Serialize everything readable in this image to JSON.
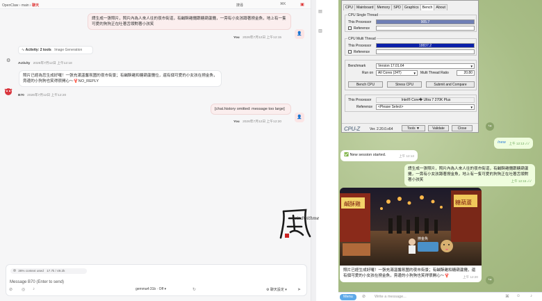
{
  "left": {
    "breadcrumb": {
      "app": "OpenClaw",
      "sep1": "›",
      "session": "main",
      "sep2": "›",
      "channel": "聊天"
    },
    "search": {
      "label": "搜尋",
      "kbd": "⌘K"
    },
    "messages": [
      {
        "role": "user",
        "text": "請生成一張照片，照片內為人來人往的夜市街道，有鹹酥雞攤跟糖葫蘆攤，一旁有小女孩蹲著撈金魚，地上有一隻可愛的狗狗正在吐著舌頭對著小孩笑",
        "author": "You",
        "time": "2026年7月12日 上午12:15"
      },
      {
        "role": "bot",
        "text": "照片已經為您生成好囉！一張充滿溫馨氛圍的夜市街景；有鹹酥雞和糖葫蘆攤位，還有個可愛的小女孩在撈金魚，旁邊的小狗狗也笑得很開心～🦞NO_REPLY",
        "author": "B70",
        "time": "2026年7月12日 上午12:20"
      },
      {
        "role": "user",
        "text": "[chat.history omitted: message too large]",
        "author": "You",
        "time": "2026年7月12日 上午12:20"
      }
    ],
    "activity": {
      "title": "Activity: 2 tools",
      "sub": "Image Generation",
      "label": "Activity",
      "time": "2026年7月12日 上午12:18"
    },
    "composer": {
      "context": "36% context used",
      "tokens": "17.7k / 49.2k",
      "placeholder": "Message B70 (Enter to send)",
      "model": "gemma4:31b · Off",
      "settings": "聊天設定"
    }
  },
  "cpuz": {
    "tabs": [
      "CPU",
      "Mainboard",
      "Memory",
      "SPD",
      "Graphics",
      "Bench",
      "About"
    ],
    "active_tab": "Bench",
    "single": {
      "title": "CPU Single Thread",
      "this_label": "This Processor",
      "value": "905.7",
      "ref_label": "Reference",
      "fraction": 1.0
    },
    "multi": {
      "title": "CPU Multi Thread",
      "this_label": "This Processor",
      "value": "18837.2",
      "ref_label": "Reference",
      "fraction": 1.0
    },
    "benchmark_label": "Benchmark",
    "benchmark_value": "Version 17.01.64",
    "runon_label": "Run on",
    "runon_value": "All Cores (24T)",
    "ratio_label": "Multi Thread Ratio",
    "ratio_value": "20.80",
    "bench_btn": "Bench CPU",
    "stress_btn": "Stress CPU",
    "submit_btn": "Submit and Compare",
    "proc_label": "This Processor",
    "proc_value": "Intel® Core� Ultra 7 270K Plus",
    "ref_label": "Reference",
    "ref_value": "<Please Select>",
    "logo": "CPU-Z",
    "version": "Ver. 2.20.0.x64",
    "tools": "Tools",
    "validate": "Validate",
    "close": "Close"
  },
  "telegram": {
    "cmd": {
      "text": "/new",
      "time": "上午 12:13"
    },
    "session": {
      "text": "✅ New session started.",
      "time": "上午 12:13"
    },
    "prompt": {
      "text": "請生成一張照片，照片內為人來人往的夜市街道，有鹹酥雞攤跟糖葫蘆攤，一旁有小女孩蹲著撈金魚，地上有一隻可愛的狗狗正在吐著舌頭對著小孩笑",
      "time": "上午 12:15"
    },
    "reply": {
      "text": "照片已經生成好囉！一張充滿溫馨氛圍的夜市街景；有鹹酥雞和糖葫蘆攤，還有個可愛的小女孩在撈金魚，旁邊的小狗狗也笑得很開心～🦞",
      "time": "上午 12:20"
    },
    "menu": "Menu",
    "placeholder": "Write a message...",
    "photo_signs": [
      "鹹酥雞",
      "糖葫蘆",
      "撈金魚"
    ]
  },
  "watermark": {
    "text": "windwithme"
  }
}
